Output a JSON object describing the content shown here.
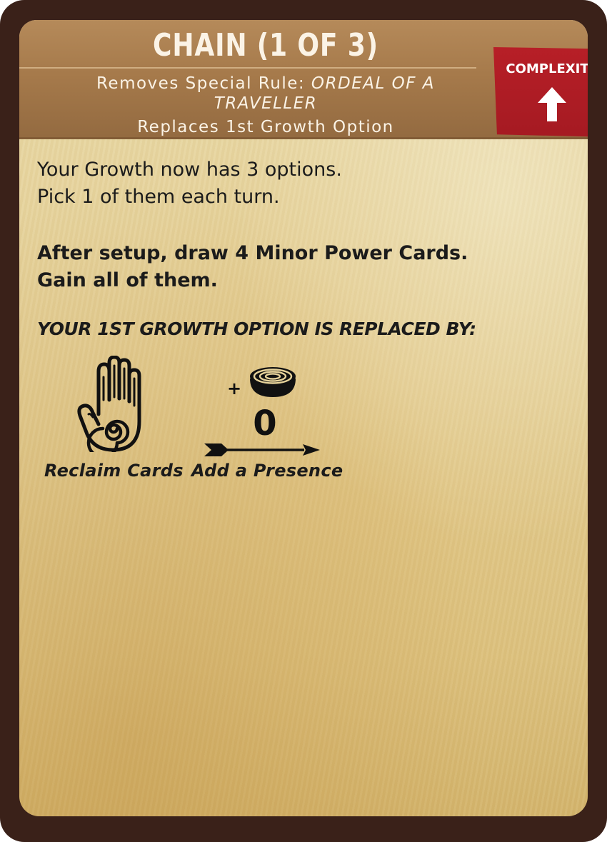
{
  "card": {
    "title": "CHAIN (1 OF 3)",
    "removes_prefix": "Removes Special Rule: ",
    "removes_rule_line1": "ORDEAL OF A",
    "removes_rule_line2": "TRAVELLER",
    "replaces": "Replaces 1st Growth Option",
    "complexity_label": "COMPLEXITY",
    "complexity_icon": "up-arrow-icon",
    "colors": {
      "frame": "#3a2119",
      "header": "#a67a4b",
      "complexity": "#a51a22",
      "parchment": "#e4cf95"
    }
  },
  "rules": {
    "line1": "Your Growth now has 3 options.",
    "line2": "Pick 1 of them each turn.",
    "line3": "After setup, draw 4 Minor Power Cards.",
    "line4": "Gain all of them.",
    "line5": "YOUR 1ST GROWTH OPTION IS REPLACED BY:"
  },
  "growth": {
    "options": [
      {
        "icon": "reclaim-hand-icon",
        "label": "Reclaim Cards"
      },
      {
        "icon": "presence-icon",
        "plus": "+",
        "range": "0",
        "label": "Add a Presence"
      }
    ]
  }
}
